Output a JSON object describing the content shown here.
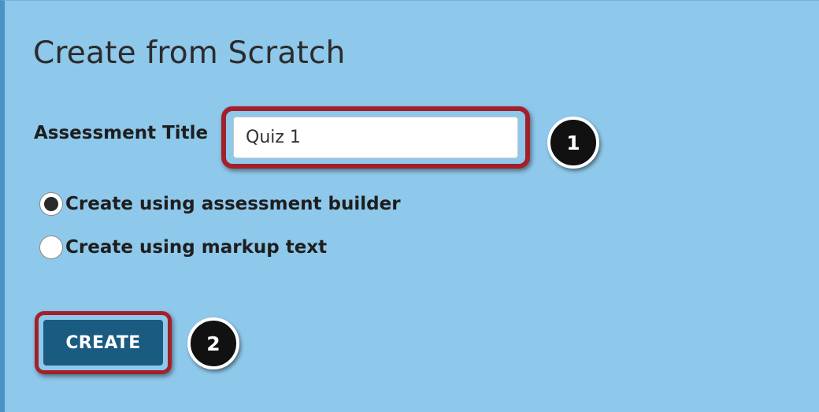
{
  "panel": {
    "title": "Create from Scratch"
  },
  "assessment_title": {
    "label": "Assessment Title",
    "value": "Quiz 1"
  },
  "create_mode": {
    "options": [
      {
        "label": "Create using assessment builder",
        "selected": true
      },
      {
        "label": "Create using markup text",
        "selected": false
      }
    ]
  },
  "actions": {
    "create_label": "CREATE"
  },
  "callouts": {
    "step_1": "1",
    "step_2": "2"
  },
  "colors": {
    "panel_background": "#8ec8ea",
    "highlight_border": "#a3202a",
    "primary_button": "#1a5b82",
    "callout_background": "#111111"
  }
}
